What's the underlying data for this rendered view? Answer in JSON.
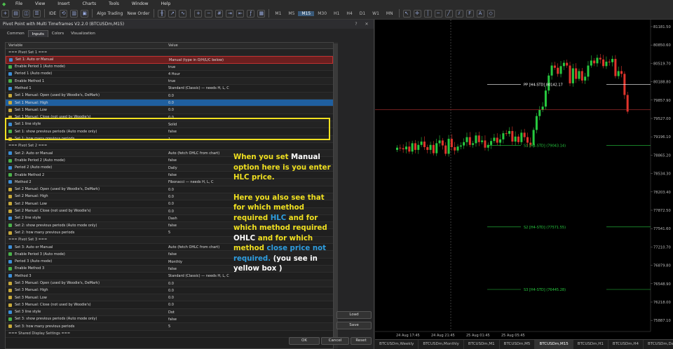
{
  "menu": [
    "File",
    "View",
    "Insert",
    "Charts",
    "Tools",
    "Window",
    "Help"
  ],
  "toolbar": {
    "ide": "IDE",
    "algo": "Algo Trading",
    "new_order": "New Order",
    "timeframes": [
      "M1",
      "M5",
      "M15",
      "M30",
      "H1",
      "H4",
      "D1",
      "W1",
      "MN"
    ],
    "active_tf": "M15"
  },
  "dialog": {
    "title": "Pivot Point with Multi Timeframes V2.2.0 (BTCUSDm,M15)",
    "tabs": [
      "Common",
      "Inputs",
      "Colors",
      "Visualization"
    ],
    "active_tab": "Inputs",
    "col_variable": "Variable",
    "col_value": "Value",
    "rows": [
      {
        "k": "sec",
        "var": "=== Pivot Set 1 ===",
        "val": ""
      },
      {
        "k": "a",
        "var": "Set 1: Auto or Manual",
        "val": "Manual (type in O/H/L/C below)",
        "hl": "red"
      },
      {
        "k": "b",
        "var": "Enable Period 1 (Auto mode)",
        "val": "true"
      },
      {
        "k": "a",
        "var": "Period 1 (Auto mode)",
        "val": "4 Hour"
      },
      {
        "k": "b",
        "var": "Enable Method 1",
        "val": "true"
      },
      {
        "k": "a",
        "var": "Method 1",
        "val": "Standard (Classic) — needs H, L, C"
      },
      {
        "k": "c",
        "var": "Set 1 Manual: Open  (used by Woodie's, DeMark)",
        "val": "0.0"
      },
      {
        "k": "c",
        "var": "Set 1 Manual: High",
        "val": "0.0",
        "hl": "sel"
      },
      {
        "k": "c",
        "var": "Set 1 Manual: Low",
        "val": "0.0"
      },
      {
        "k": "c",
        "var": "Set 1 Manual: Close (not used by Woodie's)",
        "val": "0.0"
      },
      {
        "k": "a",
        "var": "Set 1 line style",
        "val": "Solid"
      },
      {
        "k": "b",
        "var": "Set 1: show previous periods (Auto mode only)",
        "val": "false"
      },
      {
        "k": "c",
        "var": "Set 1: how many previous periods",
        "val": "1"
      },
      {
        "k": "sec",
        "var": "=== Pivot Set 2 ===",
        "val": ""
      },
      {
        "k": "a",
        "var": "Set 2: Auto or Manual",
        "val": "Auto (fetch OHLC from chart)"
      },
      {
        "k": "b",
        "var": "Enable Period 2 (Auto mode)",
        "val": "false"
      },
      {
        "k": "a",
        "var": "Period 2 (Auto mode)",
        "val": "Daily"
      },
      {
        "k": "b",
        "var": "Enable Method 2",
        "val": "false"
      },
      {
        "k": "a",
        "var": "Method 2",
        "val": "Fibonacci — needs H, L, C"
      },
      {
        "k": "c",
        "var": "Set 2 Manual: Open  (used by Woodie's, DeMark)",
        "val": "0.0"
      },
      {
        "k": "c",
        "var": "Set 2 Manual: High",
        "val": "0.0"
      },
      {
        "k": "c",
        "var": "Set 2 Manual: Low",
        "val": "0.0"
      },
      {
        "k": "c",
        "var": "Set 2 Manual: Close (not used by Woodie's)",
        "val": "0.0"
      },
      {
        "k": "a",
        "var": "Set 2 line style",
        "val": "Dash"
      },
      {
        "k": "b",
        "var": "Set 2: show previous periods (Auto mode only)",
        "val": "false"
      },
      {
        "k": "c",
        "var": "Set 2: how many previous periods",
        "val": "5"
      },
      {
        "k": "sec",
        "var": "=== Pivot Set 3 ===",
        "val": ""
      },
      {
        "k": "a",
        "var": "Set 3: Auto or Manual",
        "val": "Auto (fetch OHLC from chart)"
      },
      {
        "k": "b",
        "var": "Enable Period 3 (Auto mode)",
        "val": "false"
      },
      {
        "k": "a",
        "var": "Period 3 (Auto mode)",
        "val": "Monthly"
      },
      {
        "k": "b",
        "var": "Enable Method 3",
        "val": "false"
      },
      {
        "k": "a",
        "var": "Method 3",
        "val": "Standard (Classic) — needs H, L, C"
      },
      {
        "k": "c",
        "var": "Set 3 Manual: Open  (used by Woodie's, DeMark)",
        "val": "0.0"
      },
      {
        "k": "c",
        "var": "Set 3 Manual: High",
        "val": "0.0"
      },
      {
        "k": "c",
        "var": "Set 3 Manual: Low",
        "val": "0.0"
      },
      {
        "k": "c",
        "var": "Set 3 Manual: Close (not used by Woodie's)",
        "val": "0.0"
      },
      {
        "k": "a",
        "var": "Set 3 line style",
        "val": "Dot"
      },
      {
        "k": "b",
        "var": "Set 3: show previous periods (Auto mode only)",
        "val": "false"
      },
      {
        "k": "c",
        "var": "Set 3: how many previous periods",
        "val": "5"
      },
      {
        "k": "sec",
        "var": "=== Shared Display Settings ===",
        "val": ""
      }
    ],
    "load": "Load",
    "save": "Save",
    "ok": "OK",
    "cancel": "Cancel",
    "reset": "Reset"
  },
  "note": {
    "p1_a": "When you set ",
    "p1_b": "Manual",
    "p1_c": " option here is you enter HLC price.",
    "p2_a": "Here you also see that for which method required ",
    "p2_b": "HLC",
    "p2_c": " and for which method required ",
    "p2_d": "OHLC",
    "p2_e": " and for which method ",
    "p2_f": "close price not required.",
    "p2_g": " (you see in yellow box )"
  },
  "chart": {
    "price_labels": [
      "81181.50",
      "80850.60",
      "80519.70",
      "80188.80",
      "79857.90",
      "79527.00",
      "79196.10",
      "78865.20",
      "78534.30",
      "78203.40",
      "77872.50",
      "77541.60",
      "77210.70",
      "76879.80",
      "76548.90",
      "76218.00",
      "75887.10"
    ],
    "pp_label": "PP [H4-STD]  80142.17",
    "s1_label": "S1 [H4-STD]  (79043.14)",
    "s2_label": "S2 [H4-STD]  (77571.55)",
    "s3_label": "S3 [H4-STD]  (76445.28)",
    "current_price": "79683.70",
    "time_labels": [
      "24 Aug 17:45",
      "24 Aug 21:45",
      "25 Aug 01:45",
      "25 Aug 05:45"
    ]
  },
  "bottom_tabs": [
    "BTCUSDm,Weekly",
    "BTCUSDm,Monthly",
    "BTCUSDm,M1",
    "BTCUSDm,M5",
    "BTCUSDm,M15",
    "BTCUSDm,H1",
    "BTCUSDm,H4",
    "BTCUSDm,Daily"
  ],
  "active_bottom_tab": "BTCUSDm,M15",
  "colors": {
    "accent_yellow": "#f0e020",
    "bull": "#27c93f",
    "bear": "#e0342c",
    "pivot_line": "#ffffff",
    "support_line": "#27c93f"
  }
}
